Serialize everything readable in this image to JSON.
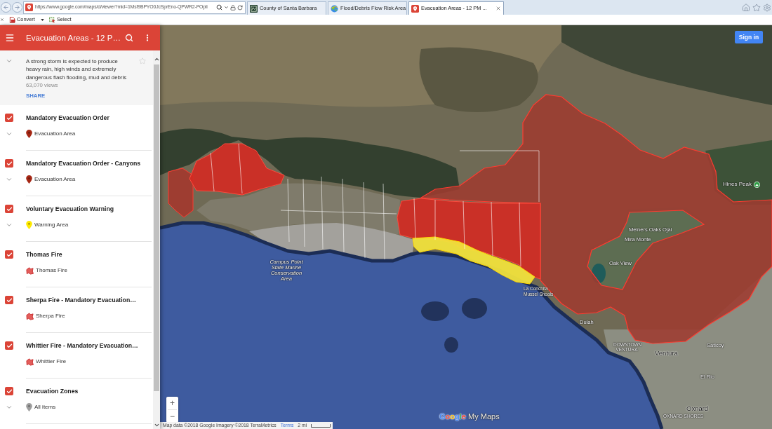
{
  "browser": {
    "address_bar": {
      "url": "https://www.google.com/maps/d/viewer?mid=1Msf9BPYO0JcSprEno-QPWR2-POpli"
    },
    "tabs": [
      {
        "title": "County of Santa Barbara",
        "kind": "county",
        "selected": false
      },
      {
        "title": "Flood/Debris Flow Risk Area",
        "kind": "globe",
        "selected": false
      },
      {
        "title": "Evacuation Areas - 12 PM ...",
        "kind": "maps",
        "selected": true
      }
    ],
    "command_bar": [
      {
        "label": "Convert",
        "kind": "convert",
        "menu": true
      },
      {
        "label": "Select",
        "kind": "select",
        "menu": false
      }
    ]
  },
  "sidebar": {
    "title": "Evacuation Areas - 12 P…",
    "description": {
      "text": "A strong storm is expected to produce heavy rain, high winds and extremely dangerous flash flooding, mud and debris",
      "views": "63,070 views",
      "share": "SHARE",
      "starred": false
    },
    "layers": [
      {
        "title": "Mandatory Evacuation Order",
        "checked": true,
        "expandable": true,
        "legend": {
          "kind": "pin",
          "color": "#a52714",
          "label": "Evacuation Area"
        }
      },
      {
        "title": "Mandatory Evacuation Order - Canyons",
        "checked": true,
        "expandable": true,
        "legend": {
          "kind": "pin",
          "color": "#a52714",
          "label": "Evacuation Area"
        }
      },
      {
        "title": "Voluntary Evacuation Warning",
        "checked": true,
        "expandable": true,
        "legend": {
          "kind": "pin",
          "color": "#ffea00",
          "label": "Warning Area"
        }
      },
      {
        "title": "Thomas Fire",
        "checked": true,
        "expandable": false,
        "legend": {
          "kind": "shape",
          "color": "#e35d5b",
          "label": "Thomas Fire"
        }
      },
      {
        "title": "Sherpa Fire - Mandatory Evacuation…",
        "checked": true,
        "expandable": false,
        "legend": {
          "kind": "shape",
          "color": "#e35d5b",
          "label": "Sherpa Fire"
        }
      },
      {
        "title": "Whittier Fire - Mandatory Evacuation…",
        "checked": true,
        "expandable": false,
        "legend": {
          "kind": "shape",
          "color": "#e35d5b",
          "label": "Whittier Fire"
        }
      },
      {
        "title": "Evacuation Zones",
        "checked": true,
        "expandable": true,
        "legend": {
          "kind": "pin",
          "color": "#9e9e9e",
          "label": "All items"
        }
      }
    ]
  },
  "map": {
    "sign_in": "Sign in",
    "zoom": {
      "in": "+",
      "out": "−"
    },
    "places": [
      {
        "name": "Hines Peak",
        "kind": "peak"
      },
      {
        "name": "Meiners Oaks",
        "kind": "town"
      },
      {
        "name": "Ojai",
        "kind": "town"
      },
      {
        "name": "Mira Monte",
        "kind": "town"
      },
      {
        "name": "Campus Point State Marine Conservation Area",
        "kind": "park"
      },
      {
        "name": "Oak View",
        "kind": "town"
      },
      {
        "name": "La Conchita",
        "kind": "locality"
      },
      {
        "name": "Mussel Shoals",
        "kind": "locality"
      },
      {
        "name": "Dulah",
        "kind": "town"
      },
      {
        "name": "Saticoy",
        "kind": "town"
      },
      {
        "name": "DOWNTOWN VENTURA",
        "kind": "district"
      },
      {
        "name": "Ventura",
        "kind": "city"
      },
      {
        "name": "El Rio",
        "kind": "town"
      },
      {
        "name": "Oxnard",
        "kind": "city"
      },
      {
        "name": "OXNARD SHORES",
        "kind": "district"
      }
    ],
    "logo": {
      "brand": "Google",
      "product": "My Maps"
    },
    "attribution": "Map data ©2018 Google Imagery ©2018 TerraMetrics",
    "terms": "Terms",
    "scale": "2 mi"
  }
}
